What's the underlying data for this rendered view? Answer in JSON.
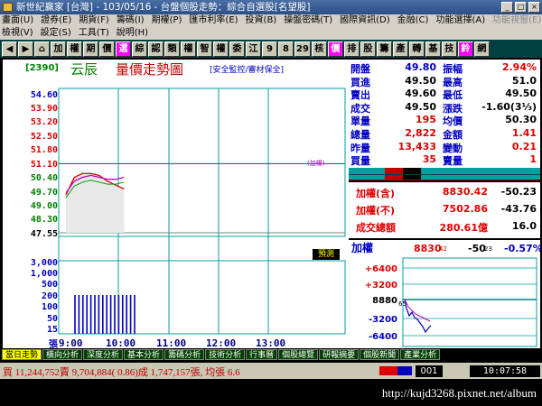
{
  "window": {
    "title": "新世紀贏家 [台灣] - 103/05/16 - 台盤個股走勢：綜合自選股[名望股]"
  },
  "menu": {
    "row1": [
      "畫面(U)",
      "證券(E)",
      "期貨(F)",
      "籌碼(I)",
      "期權(P)",
      "匯市利率(E)",
      "投資(B)",
      "操盤密碼(T)",
      "國際資訊(D)",
      "金融(C)",
      "功能選擇(A)",
      "功能視窗(E)"
    ],
    "row1_disabled": [
      false,
      false,
      false,
      false,
      false,
      false,
      false,
      false,
      false,
      false,
      false,
      true
    ],
    "row2": [
      "檢視(V)",
      "設定(S)",
      "工具(T)",
      "說明(H)"
    ]
  },
  "toolbar": [
    "加",
    "權",
    "期",
    "價",
    "選",
    "綜",
    "認",
    "類",
    "權",
    "智",
    "權",
    "委",
    "江",
    "9",
    "8",
    "29",
    "核",
    "價",
    "排",
    "股",
    "籌",
    "產",
    "轉",
    "基",
    "技",
    "鈴",
    "網"
  ],
  "chart": {
    "code": "[2390]",
    "stock_name": "云辰",
    "title": "量價走勢圖",
    "tag": "[安全監控/審材保全]",
    "price_ticks": [
      "54.60",
      "53.90",
      "53.20",
      "52.50",
      "51.80",
      "51.10",
      "50.40",
      "49.70",
      "49.00",
      "48.30",
      "47.55"
    ],
    "price_colors": [
      "#0000c0",
      "#e00000",
      "#e00000",
      "#e00000",
      "#e00000",
      "#e00000",
      "#008000",
      "#008000",
      "#008000",
      "#008000",
      "#000000"
    ],
    "vol_ticks": [
      "3,000",
      "1,000",
      "500",
      "200",
      "100",
      "50",
      "15",
      "張"
    ],
    "time_ticks": [
      "9:00",
      "10:00",
      "11:00",
      "12:00",
      "13:00"
    ],
    "predict_label": "預測",
    "ref_mark": "(加權)"
  },
  "chart_data": {
    "type": "line",
    "title": "量價走勢圖",
    "xlabel": "",
    "ylabel": "",
    "x": [
      "9:00",
      "9:10",
      "9:20",
      "9:30",
      "9:40",
      "9:50",
      "10:00",
      "10:10"
    ],
    "series": [
      {
        "values": [
          49.5,
          50.4,
          50.6,
          50.6,
          50.5,
          50.2,
          50.0,
          49.8
        ]
      },
      {
        "values": [
          49.6,
          50.2,
          50.4,
          50.5,
          50.4,
          50.3,
          50.3,
          50.4
        ]
      }
    ],
    "ylim": [
      47.55,
      54.6
    ]
  },
  "quote": {
    "rows": [
      {
        "l1": "開盤",
        "v1": "49.80",
        "l2": "振幅",
        "v2": "2.94%",
        "c1": "#0000c0",
        "c2": "#e00000"
      },
      {
        "l1": "買進",
        "v1": "49.50",
        "l2": "最高",
        "v2": "51.0",
        "c1": "#000000",
        "c2": "#000000"
      },
      {
        "l1": "賣出",
        "v1": "49.60",
        "l2": "最低",
        "v2": "49.50",
        "c1": "#000000",
        "c2": "#000000"
      },
      {
        "l1": "成交",
        "v1": "49.50",
        "l2": "漲跌",
        "v2": "-1.60(3⅓)",
        "c1": "#000000",
        "c2": "#000000"
      },
      {
        "l1": "單量",
        "v1": "195",
        "l2": "均價",
        "v2": "50.30",
        "c1": "#e00000",
        "c2": "#000000"
      },
      {
        "l1": "總量",
        "v1": "2,822",
        "l2": "金額",
        "v2": "1.41",
        "c1": "#e00000",
        "c2": "#e00000"
      },
      {
        "l1": "昨量",
        "v1": "13,433",
        "l2": "變動",
        "v2": "0.21",
        "c1": "#e00000",
        "c2": "#e00000"
      },
      {
        "l1": "買量",
        "v1": "35",
        "l2": "賣量",
        "v2": "1",
        "c1": "#e00000",
        "c2": "#e00000"
      }
    ]
  },
  "index": {
    "rows": [
      {
        "label": "加權(含)",
        "value": "8830.42",
        "chg": "-50.23"
      },
      {
        "label": "加權(不)",
        "value": "7502.86",
        "chg": "-43.76"
      },
      {
        "label": "成交總額",
        "value": "280.61億",
        "chg": "16.0"
      }
    ]
  },
  "mini": {
    "label": "加權",
    "value": "8830",
    "value_small": "42",
    "chg": "-50",
    "chg_small": "23",
    "pct": "-0.57%",
    "ticks": [
      "+6400",
      "+3200",
      "8880",
      "-3200",
      "-6400"
    ],
    "tick_small": "65"
  },
  "tabs": [
    "當日走勢",
    "橫向分析",
    "深度分析",
    "基本分析",
    "籌碼分析",
    "技術分析",
    "行事曆",
    "個股總覽",
    "研報摘要",
    "個股新聞",
    "產業分析"
  ],
  "status": {
    "message": "買 11,244,752賣 9,704,884( 0.86)成 1,747,157張, 均張 6.6",
    "counter": "001",
    "clock": "10:07:58"
  },
  "watermark": "http://kujd3268.pixnet.net/album"
}
